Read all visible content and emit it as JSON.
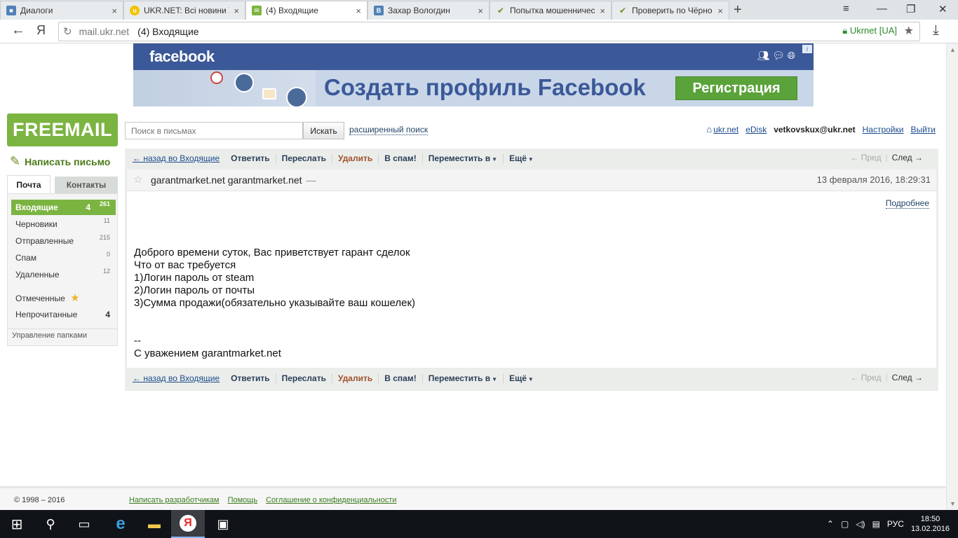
{
  "browser": {
    "tabs": [
      {
        "title": "Диалоги",
        "active": false
      },
      {
        "title": "UKR.NET: Всі новини У",
        "active": false
      },
      {
        "title": "(4) Входящие",
        "active": true
      },
      {
        "title": "Захар Вологдин",
        "active": false
      },
      {
        "title": "Попытка мошенничес",
        "active": false
      },
      {
        "title": "Проверить по Чёрно",
        "active": false
      }
    ],
    "url_host": "mail.ukr.net",
    "url_title": "(4) Входящие",
    "secure_label": "Ukrnet [UA]",
    "yandex_glyph": "Я"
  },
  "ad": {
    "brand": "facebook",
    "headline": "Создать профиль Facebook",
    "button": "Регистрация"
  },
  "logo": "FREEMAIL",
  "search": {
    "placeholder": "Поиск в письмах",
    "button": "Искать",
    "advanced": "расширенный поиск"
  },
  "toplinks": {
    "home": "ukr.net",
    "edisk": "eDisk",
    "user": "vetkovskux@ukr.net",
    "settings": "Настройки",
    "logout": "Выйти"
  },
  "compose": "Написать письмо",
  "folder_tabs": {
    "mail": "Почта",
    "contacts": "Контакты"
  },
  "folders": {
    "inbox": {
      "label": "Входящие",
      "unread": "4",
      "total": "261"
    },
    "drafts": {
      "label": "Черновики",
      "total": "11"
    },
    "sent": {
      "label": "Отправленные",
      "total": "215"
    },
    "spam": {
      "label": "Спам",
      "total": "0"
    },
    "deleted": {
      "label": "Удаленные",
      "total": "12"
    },
    "flagged": {
      "label": "Отмеченные"
    },
    "unread": {
      "label": "Непрочитанные",
      "count": "4"
    },
    "manage": "Управление папками"
  },
  "toolbar": {
    "back": "← назад во Входящие",
    "reply": "Ответить",
    "forward": "Переслать",
    "delete": "Удалить",
    "spam": "В спам!",
    "move": "Переместить в",
    "more": "Ещё",
    "prev": "← Пред",
    "next": "След →"
  },
  "message": {
    "from": "garantmarket.net garantmarket.net",
    "dash": "—",
    "date": "13 февраля 2016, 18:29:31",
    "more_link": "Подробнее",
    "body": "Доброго времени суток, Вас приветствует гарант сделок\nЧто от вас требуется\n1)Логин пароль от steam\n2)Логин пароль от почты\n3)Сумма продажи(обязательно указывайте ваш кошелек)\n\n\n--\nС уважением garantmarket.net"
  },
  "footer": {
    "copyright": "© 1998 – 2016",
    "links": [
      "Написать разработчикам",
      "Помощь",
      "Соглашение о конфиденциальности"
    ]
  },
  "taskbar": {
    "lang": "РУС",
    "time": "18:50",
    "date": "13.02.2016"
  },
  "colors": {
    "brand_green": "#7cb442",
    "facebook_blue": "#3b5998",
    "link_blue": "#1a4c8c"
  }
}
